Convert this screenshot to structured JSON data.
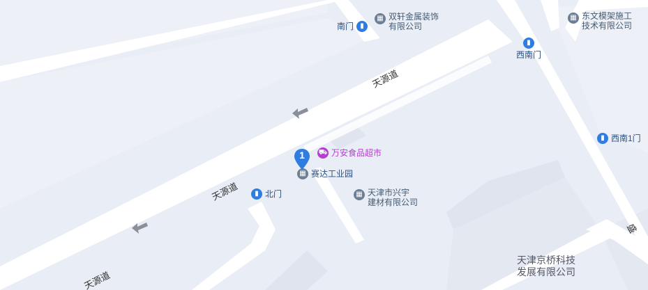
{
  "roads": {
    "tianyuan_1": "天源道",
    "tianyuan_2": "天源道",
    "tianyuan_3": "天源道",
    "sheng_partial": "盛"
  },
  "pois": {
    "nanmen": "南门",
    "shuangxuan": [
      "双轩金属装饰",
      "有限公司"
    ],
    "dongwen": [
      "东文模架施工",
      "技术有限公司"
    ],
    "xinanmen": "西南门",
    "xinan1men": "西南1门",
    "wanan": "万安食品超市",
    "saida": "赛达工业园",
    "beimen": "北门",
    "xingyu": [
      "天津市兴宇",
      "建材有限公司"
    ],
    "jingqiao": [
      "天津京桥科技",
      "发展有限公司"
    ]
  },
  "marker": {
    "number": "1"
  },
  "colors": {
    "background": "#e9edf5",
    "road": "#ffffff",
    "building": "#dfe4ee",
    "pin_blue": "#2f7de1",
    "pin_gray": "#6c7f95",
    "pin_purple": "#b43fd0"
  }
}
